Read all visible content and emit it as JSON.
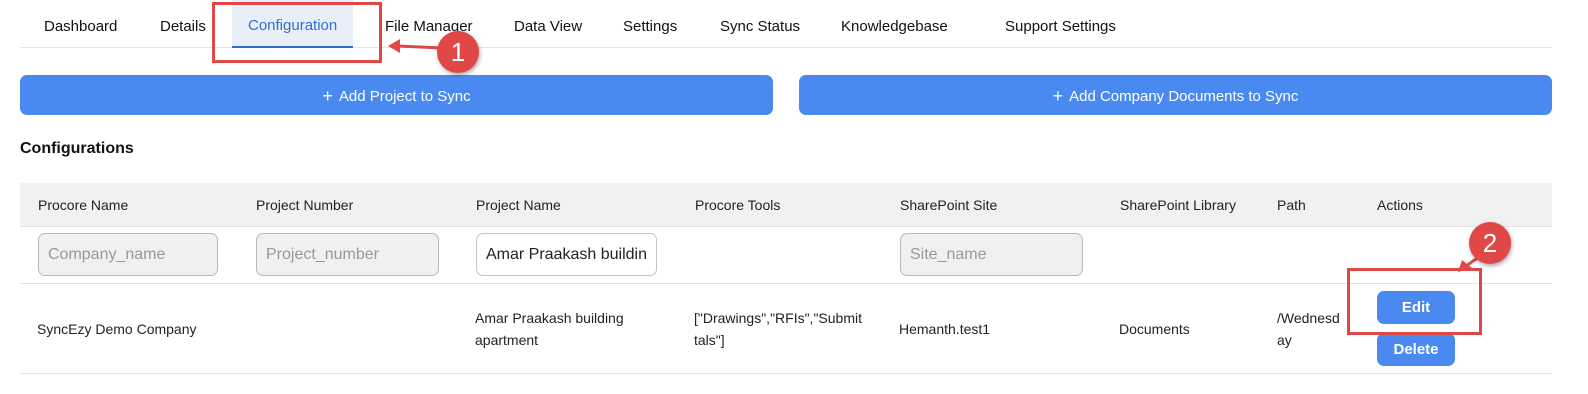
{
  "tabs": [
    {
      "label": "Dashboard"
    },
    {
      "label": "Details"
    },
    {
      "label": "Configuration",
      "active": true
    },
    {
      "label": "File Manager"
    },
    {
      "label": "Data View"
    },
    {
      "label": "Settings"
    },
    {
      "label": "Sync Status"
    },
    {
      "label": "Knowledgebase"
    },
    {
      "label": "Support Settings"
    }
  ],
  "actions": {
    "add_project": "Add Project to Sync",
    "add_company_docs": "Add Company Documents to Sync",
    "plus_icon": "+"
  },
  "section_title": "Configurations",
  "table": {
    "columns": [
      "Procore Name",
      "Project Number",
      "Project Name",
      "Procore Tools",
      "SharePoint Site",
      "SharePoint Library",
      "Path",
      "Actions"
    ],
    "filters": {
      "company_placeholder": "Company_name",
      "project_number_placeholder": "Project_number",
      "project_name_value": "Amar Praakash building apartment",
      "site_placeholder": "Site_name"
    },
    "rows": [
      {
        "procore_name": "SyncEzy Demo Company",
        "project_number": "",
        "project_name_line1": "Amar Praakash building",
        "project_name_line2": "apartment",
        "tools_line1": "[\"Drawings\",\"RFIs\",\"Submit",
        "tools_line2": "tals\"]",
        "site": "Hemanth.test1",
        "library": "Documents",
        "path_line1": "/Wednesd",
        "path_line2": "ay",
        "edit_label": "Edit",
        "delete_label": "Delete"
      }
    ]
  },
  "annotations": {
    "badge_1": "1",
    "badge_2": "2",
    "color": "#e04848"
  },
  "colors": {
    "accent": "#4a8af0",
    "active_tab_text": "#2f6fd1"
  }
}
